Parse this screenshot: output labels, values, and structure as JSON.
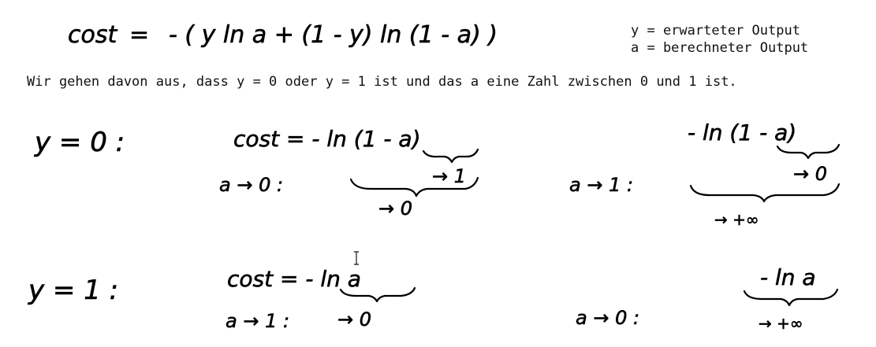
{
  "formula": {
    "lhs": "cost",
    "eq": "=",
    "rhs": "- ( y ln a + (1 - y) ln (1 - a) )"
  },
  "legend": {
    "y_line": "y = erwarteter Output",
    "a_line": "a = berechneter Output"
  },
  "assumption": "Wir gehen davon aus, dass y = 0 oder y = 1 ist und das a eine Zahl zwischen 0 und 1 ist.",
  "case_y0": {
    "label": "y = 0 :",
    "cost_expr": "cost  =  - ln (1 - a)",
    "limit1_label": "a → 0 :",
    "limit1_inner": "→ 1",
    "limit1_outer": "→ 0",
    "right_expr": "- ln (1 - a)",
    "limit2_label": "a → 1 :",
    "limit2_inner": "→ 0",
    "limit2_outer": "→ +∞"
  },
  "case_y1": {
    "label": "y = 1 :",
    "cost_expr": "cost  =  - ln a",
    "limit1_label": "a → 1 :",
    "limit1_result": "→ 0",
    "right_expr": "- ln a",
    "limit2_label": "a → 0 :",
    "limit2_result": "→ +∞"
  }
}
